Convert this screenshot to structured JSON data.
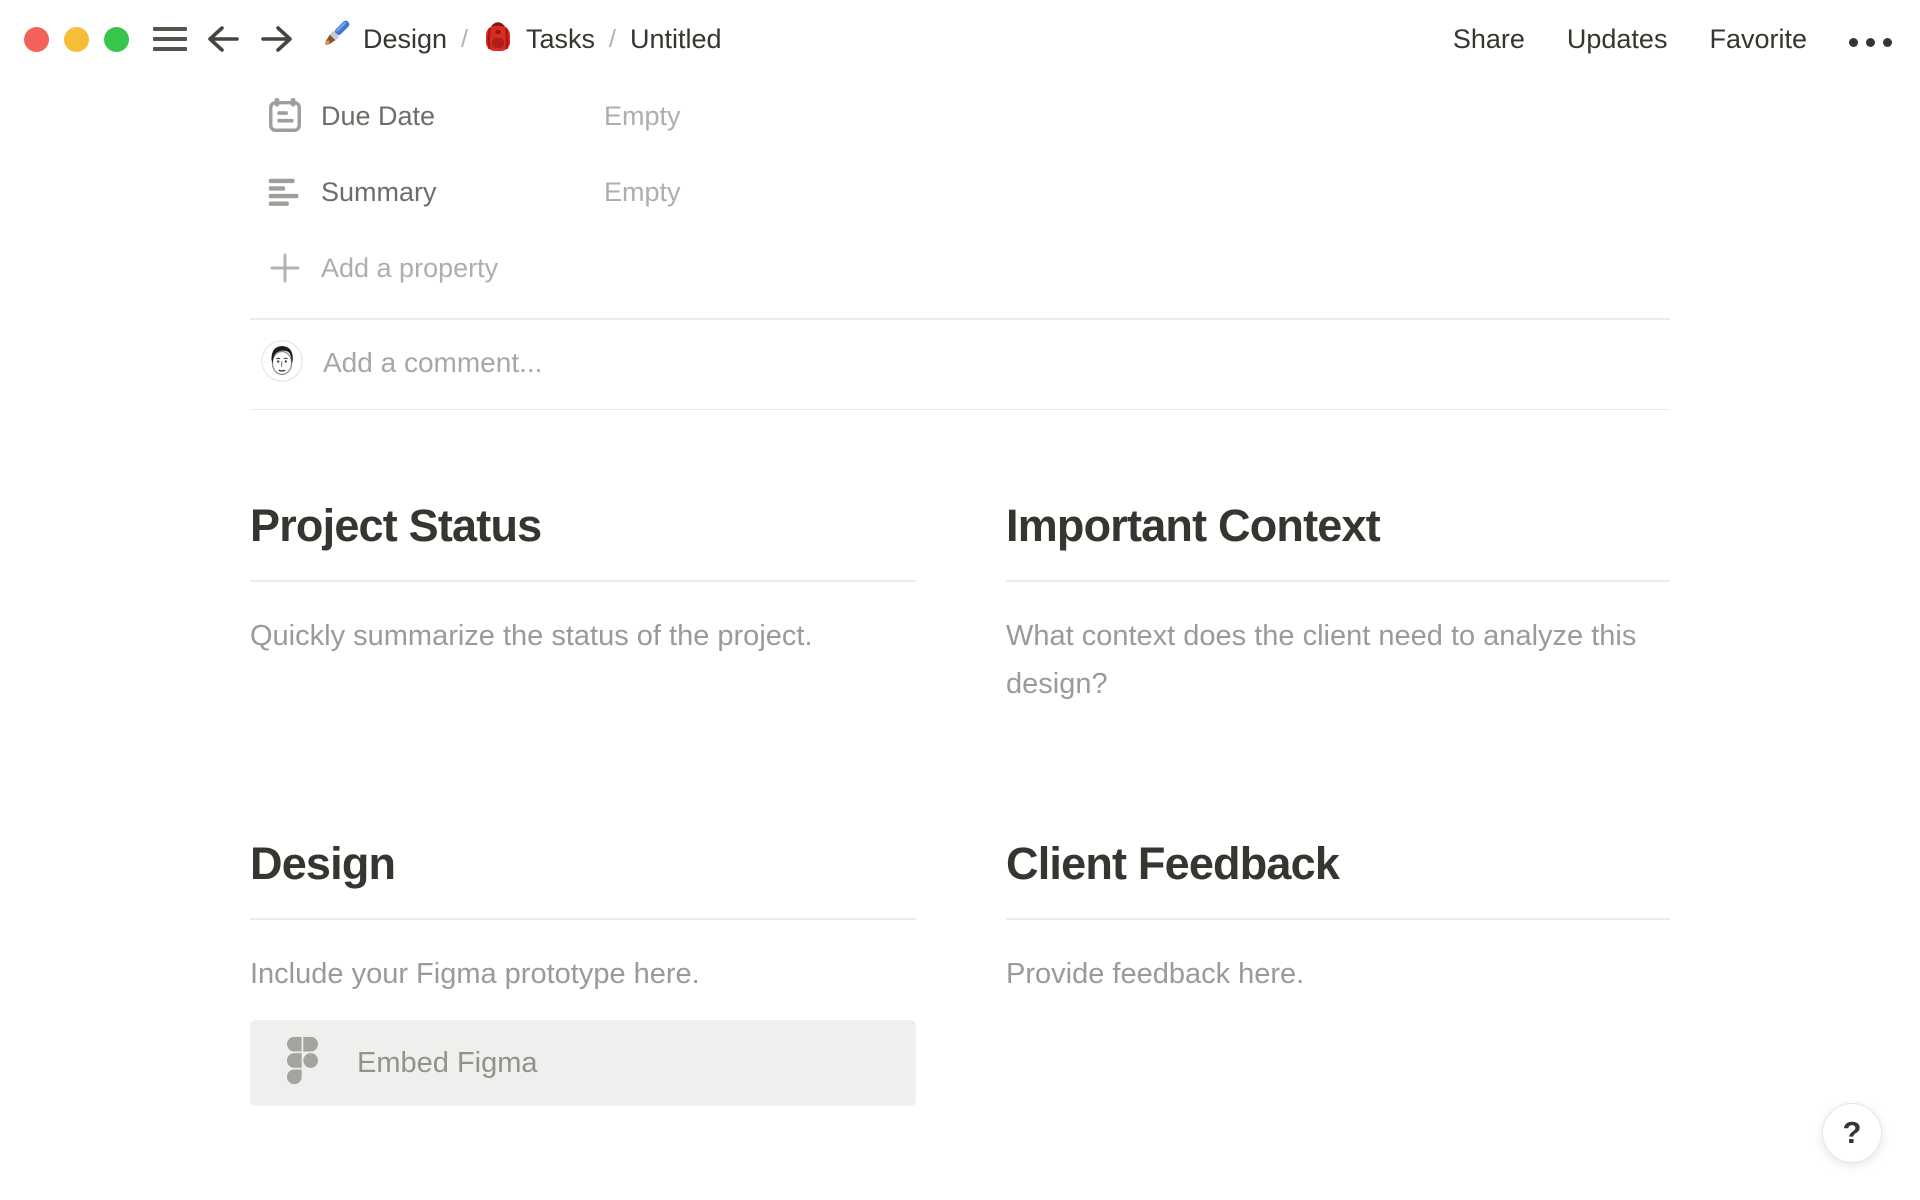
{
  "topbar": {
    "breadcrumb": {
      "separator": "/",
      "items": [
        {
          "icon": "paintbrush-icon",
          "label": "Design"
        },
        {
          "icon": "backpack-icon",
          "label": "Tasks"
        },
        {
          "label": "Untitled"
        }
      ]
    },
    "actions": {
      "share": "Share",
      "updates": "Updates",
      "favorite": "Favorite",
      "more_icon": "ellipsis-icon"
    },
    "window_controls": [
      "close",
      "minimize",
      "zoom"
    ],
    "nav_icons": [
      "menu-icon",
      "back-arrow-icon",
      "forward-arrow-icon"
    ]
  },
  "properties": {
    "rows": [
      {
        "icon": "calendar-icon",
        "label": "Due Date",
        "value": "Empty"
      },
      {
        "icon": "text-align-left-icon",
        "label": "Summary",
        "value": "Empty"
      }
    ],
    "add_property_label": "Add a property",
    "add_icon": "plus-icon"
  },
  "comment": {
    "avatar_icon": "user-avatar",
    "placeholder": "Add a comment..."
  },
  "sections": [
    {
      "title": "Project Status",
      "body": "Quickly summarize the status of the project."
    },
    {
      "title": "Important Context",
      "body": "What context does the client need to analyze this design?"
    },
    {
      "title": "Design",
      "body": "Include your Figma prototype here.",
      "embed_label": "Embed Figma",
      "embed_icon": "figma-icon"
    },
    {
      "title": "Client Feedback",
      "body": "Provide feedback here."
    }
  ],
  "help": {
    "label": "?"
  },
  "colors": {
    "traffic_red": "#f4615b",
    "traffic_yellow": "#f6bd36",
    "traffic_green": "#37c64b",
    "text_dark": "#37352f",
    "text_gray": "#9b9a97",
    "text_light_gray": "#afaeab",
    "divider": "#ebebe9",
    "embed_background": "#f0efed",
    "figma_icon_gray": "#a5a39e",
    "backpack_red": "#d92b21",
    "brush_handle_blue": "#3f76d6"
  }
}
